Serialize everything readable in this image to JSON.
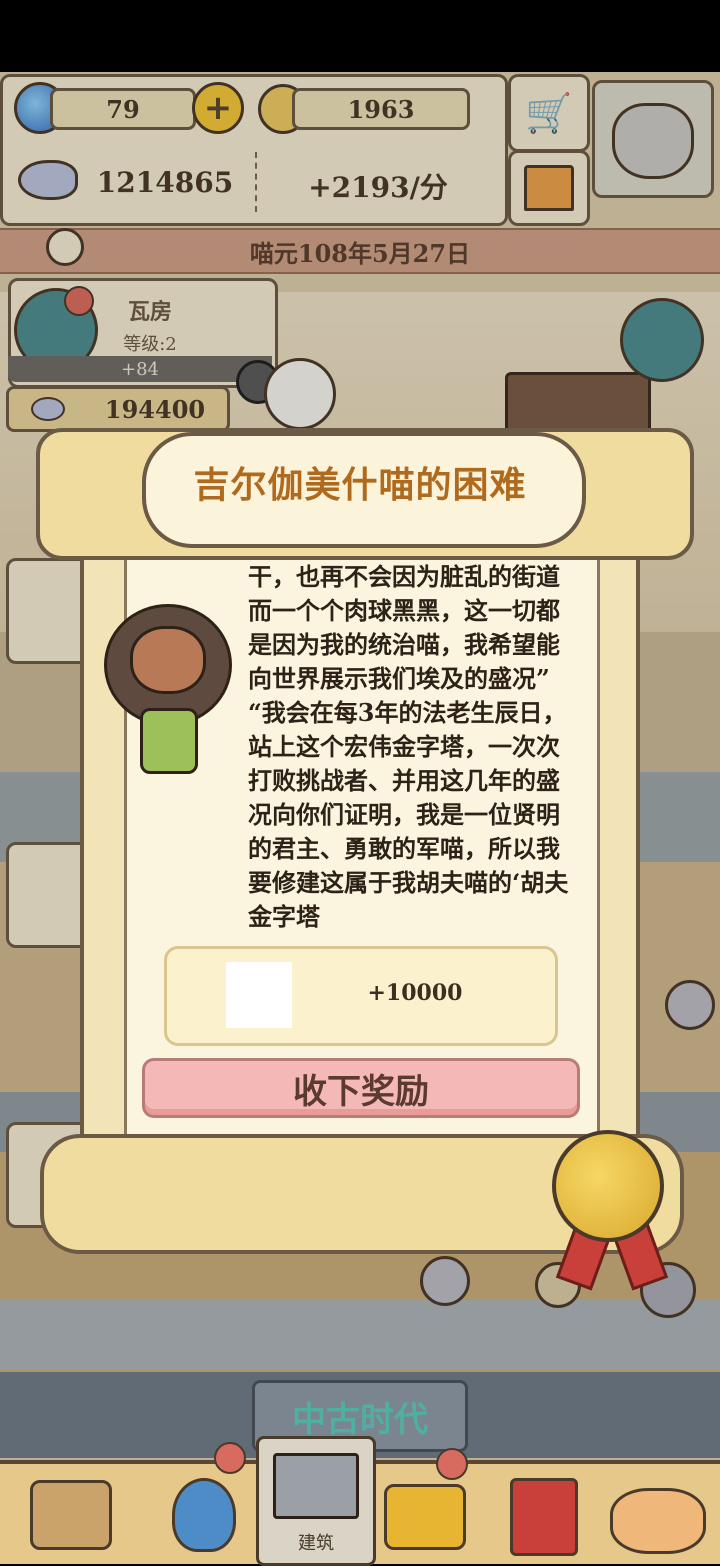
{
  "hud": {
    "gems": "79",
    "coins": "1963",
    "fish_total": "1214865",
    "fish_rate": "+2193/分",
    "date": "喵元108年5月27日"
  },
  "building_card": {
    "name": "瓦房",
    "level": "等级:2",
    "bonus": "+84",
    "cost": "194400"
  },
  "dialog": {
    "title": "吉尔伽美什喵的困难",
    "story_lines": [
      "干，也再不会因为脏乱的街道",
      "而一个个肉球黑黑，这一切都",
      "是因为我的统治喵，我希望能",
      "向世界展示我们埃及的盛况”",
      "“我会在每3年的法老生辰日，",
      "站上这个宏伟金字塔，一次次",
      "打败挑战者、并用这几年的盛",
      "况向你们证明，我是一位贤明",
      "的君主、勇敢的军喵，所以我",
      "要修建这属于我胡夫喵的‘胡夫",
      "金字塔"
    ],
    "reward_amount": "+10000",
    "claim_label": "收下奖励"
  },
  "era_banner": "中古时代",
  "bottom_nav": {
    "active_label": "建筑"
  },
  "colors": {
    "scroll": "#fbf2d5",
    "claim_button": "#f4b9b6",
    "title_text": "#b06a1e",
    "medal": "#e8b93a"
  }
}
